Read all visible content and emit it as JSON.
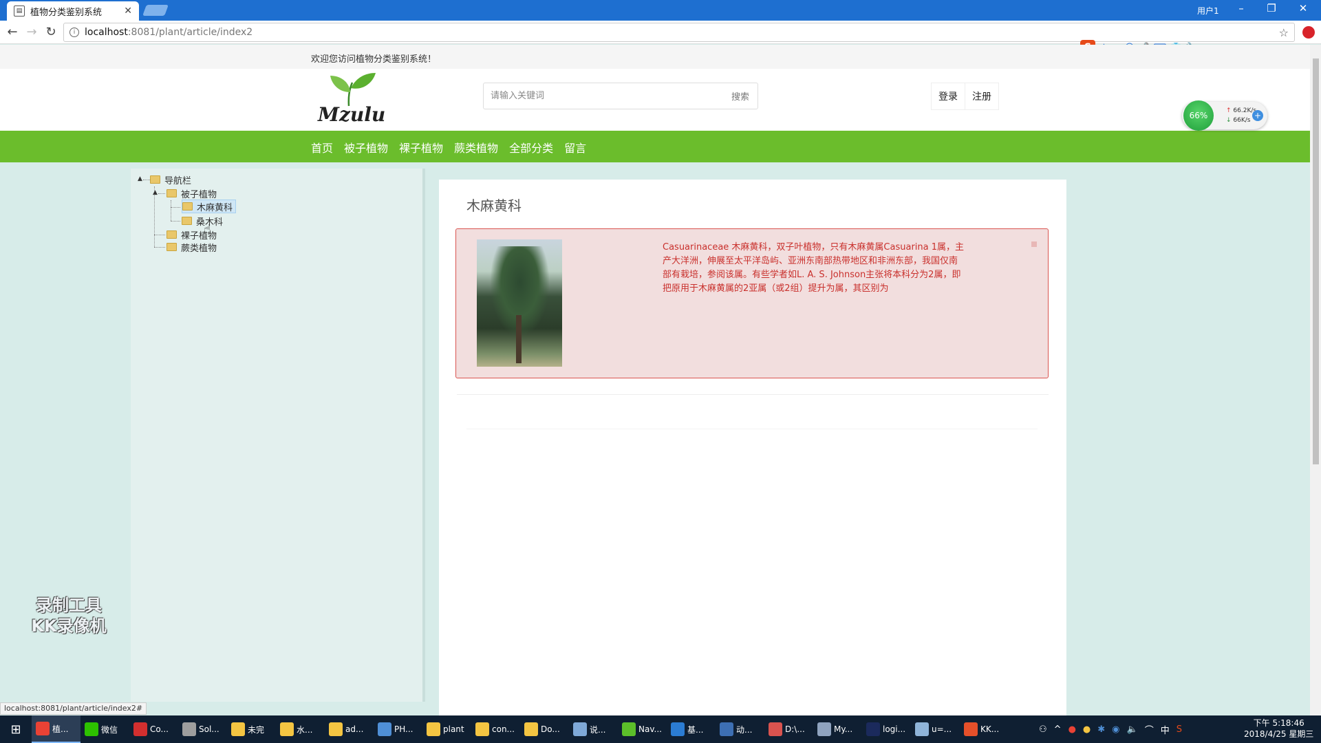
{
  "browser": {
    "tab_title": "植物分类鉴别系统",
    "profile": "用户1",
    "url_host": "localhost",
    "url_rest": ":8081/plant/article/index2",
    "status_url": "localhost:8081/plant/article/index2#"
  },
  "ime": {
    "items": [
      "中",
      "•,",
      "☺",
      "🎤",
      "⌨",
      "👕",
      "🔧"
    ]
  },
  "site": {
    "welcome": "欢迎您访问植物分类鉴别系统！",
    "logo_text": "Mzulu",
    "search_placeholder": "请输入关键词",
    "search_button": "搜索",
    "login": "登录",
    "register": "注册",
    "nav": [
      "首页",
      "被子植物",
      "裸子植物",
      "蕨类植物",
      "全部分类",
      "留言"
    ]
  },
  "tree": {
    "root": "导航栏",
    "angiosperm": "被子植物",
    "casuarinaceae": "木麻黄科",
    "second_family": "桑木科",
    "gymnosperm": "裸子植物",
    "fern": "蕨类植物"
  },
  "article": {
    "title": "木麻黄科",
    "text": "Casuarinaceae 木麻黄科，双子叶植物，只有木麻黄属Casuarina 1属，主产大洋洲，伸展至太平洋岛屿、亚洲东南部热带地区和非洲东部，我国仅南部有栽培，参阅该属。有些学者如L. A. S. Johnson主张将本科分为2属，即把原用于木麻黄属的2亚属（或2组）提升为属，其区别为"
  },
  "speed_widget": {
    "percent": "66%",
    "up": "66.2K/s",
    "down": "66K/s"
  },
  "watermark": {
    "line1": "录制工具",
    "line2": "KK录像机"
  },
  "taskbar": {
    "items": [
      {
        "label": "植...",
        "color": "#e94235"
      },
      {
        "label": "微信",
        "color": "#2dc100"
      },
      {
        "label": "Co...",
        "color": "#d32f2f"
      },
      {
        "label": "Sol...",
        "color": "#9e9e9e"
      },
      {
        "label": "未完",
        "color": "#f4c542"
      },
      {
        "label": "水...",
        "color": "#f4c542"
      },
      {
        "label": "ad...",
        "color": "#f4c542"
      },
      {
        "label": "PH...",
        "color": "#4f8fd6"
      },
      {
        "label": "plant",
        "color": "#f4c542"
      },
      {
        "label": "con...",
        "color": "#f4c542"
      },
      {
        "label": "Do...",
        "color": "#f4c542"
      },
      {
        "label": "说...",
        "color": "#7fa9d8"
      },
      {
        "label": "Nav...",
        "color": "#5cbf2a"
      },
      {
        "label": "基...",
        "color": "#2b7cd3"
      },
      {
        "label": "动...",
        "color": "#3d6fb3"
      },
      {
        "label": "D:\\...",
        "color": "#d9534f"
      },
      {
        "label": "My...",
        "color": "#8fa3bf"
      },
      {
        "label": "logi...",
        "color": "#1b2a5c"
      },
      {
        "label": "u=...",
        "color": "#8fb4d9"
      },
      {
        "label": "KK...",
        "color": "#e6502a"
      }
    ],
    "tray_lang": "中",
    "time": "下午 5:18:46",
    "date": "2018/4/25 星期三"
  }
}
